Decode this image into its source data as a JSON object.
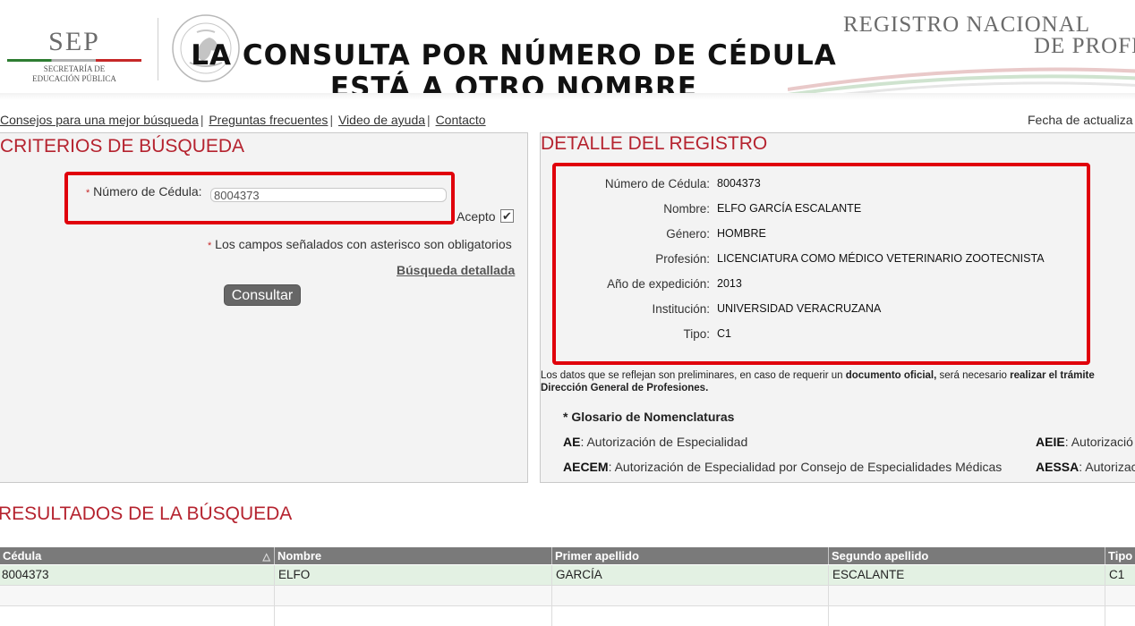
{
  "header": {
    "logo_text": "SEP",
    "logo_sub_1": "SECRETARÍA DE",
    "logo_sub_2": "EDUCACIÓN PÚBLICA",
    "overlay_line_1": "LA CONSULTA POR NÚMERO DE CÉDULA",
    "overlay_line_2": "ESTÁ A OTRO NOMBRE",
    "site_title_1": "REGISTRO NACIONAL",
    "site_title_2": "DE PROFE"
  },
  "nav": {
    "links": [
      "Consejos para una mejor búsqueda",
      "Preguntas frecuentes",
      "Video de ayuda",
      "Contacto"
    ],
    "separator": "|",
    "fecha": "Fecha de actualiza"
  },
  "criterios": {
    "title": "CRITERIOS DE BÚSQUEDA",
    "cedula_label": "Número de Cédula:",
    "cedula_value": "8004373",
    "asterisk": "*",
    "acepto_label": "Acepto",
    "acepto_checked": "✔",
    "obligatorios_text": "Los campos señalados con asterisco son obligatorios",
    "busqueda_detallada": "Búsqueda detallada",
    "consultar_button": "Consultar"
  },
  "detalle": {
    "title": "DETALLE DEL REGISTRO",
    "rows": [
      {
        "label": "Número de Cédula:",
        "value": "8004373"
      },
      {
        "label": "Nombre:",
        "value": "ELFO GARCÍA ESCALANTE"
      },
      {
        "label": "Género:",
        "value": "HOMBRE"
      },
      {
        "label": "Profesión:",
        "value": "LICENCIATURA COMO MÉDICO VETERINARIO ZOOTECNISTA"
      },
      {
        "label": "Año de expedición:",
        "value": "2013"
      },
      {
        "label": "Institución:",
        "value": "UNIVERSIDAD VERACRUZANA"
      },
      {
        "label": "Tipo:",
        "value": "C1"
      }
    ],
    "disclaimer_1a": "Los datos que se reflejan son preliminares, en caso de requerir un ",
    "disclaimer_1b": "documento oficial,",
    "disclaimer_1c": " será necesario ",
    "disclaimer_1d": "realizar el trámite",
    "disclaimer_2": "Dirección General de Profesiones.",
    "glosario_title": "* Glosario de Nomenclaturas",
    "glossary": [
      {
        "abbr": "AE",
        "desc": ": Autorización de Especialidad"
      },
      {
        "abbr": "AEIE",
        "desc": ": Autorizació"
      },
      {
        "abbr": "AECEM",
        "desc": ": Autorización de Especialidad por Consejo de Especialidades Médicas"
      },
      {
        "abbr": "AESSA",
        "desc": ": Autorizac"
      }
    ]
  },
  "resultados": {
    "title": "RESULTADOS DE LA BÚSQUEDA",
    "columns": [
      "Cédula",
      "Nombre",
      "Primer apellido",
      "Segundo apellido",
      "Tipo"
    ],
    "rows": [
      [
        "8004373",
        "ELFO",
        "GARCÍA",
        "ESCALANTE",
        "C1"
      ]
    ]
  },
  "colors": {
    "accent_red": "#b5232f",
    "highlight_box": "#e0000b",
    "table_header": "#7a7a7a",
    "selected_row": "#e3f1e3"
  },
  "icons": [
    "national-seal-icon",
    "checkbox-check-icon",
    "sort-asc-icon"
  ]
}
